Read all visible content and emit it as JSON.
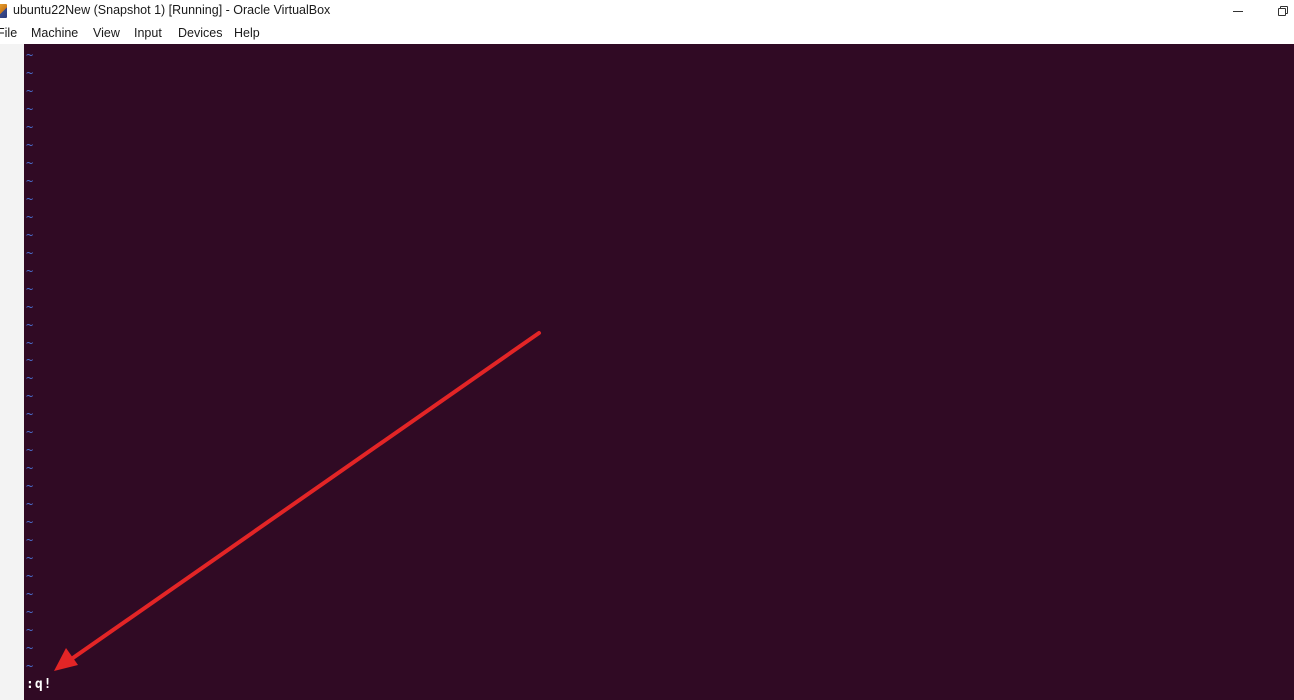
{
  "window": {
    "title": "ubuntu22New (Snapshot 1) [Running] - Oracle VirtualBox",
    "icon": "virtualbox-icon"
  },
  "menubar": {
    "items": [
      {
        "label": "File"
      },
      {
        "label": "Machine"
      },
      {
        "label": "View"
      },
      {
        "label": "Input"
      },
      {
        "label": "Devices"
      },
      {
        "label": "Help"
      }
    ]
  },
  "terminal": {
    "background": "#300a24",
    "tilde_color": "#4a6fd0",
    "empty_line_marker": "~",
    "empty_line_count": 35,
    "command_line": ":q!"
  },
  "annotation": {
    "arrow_color": "#e32526"
  }
}
